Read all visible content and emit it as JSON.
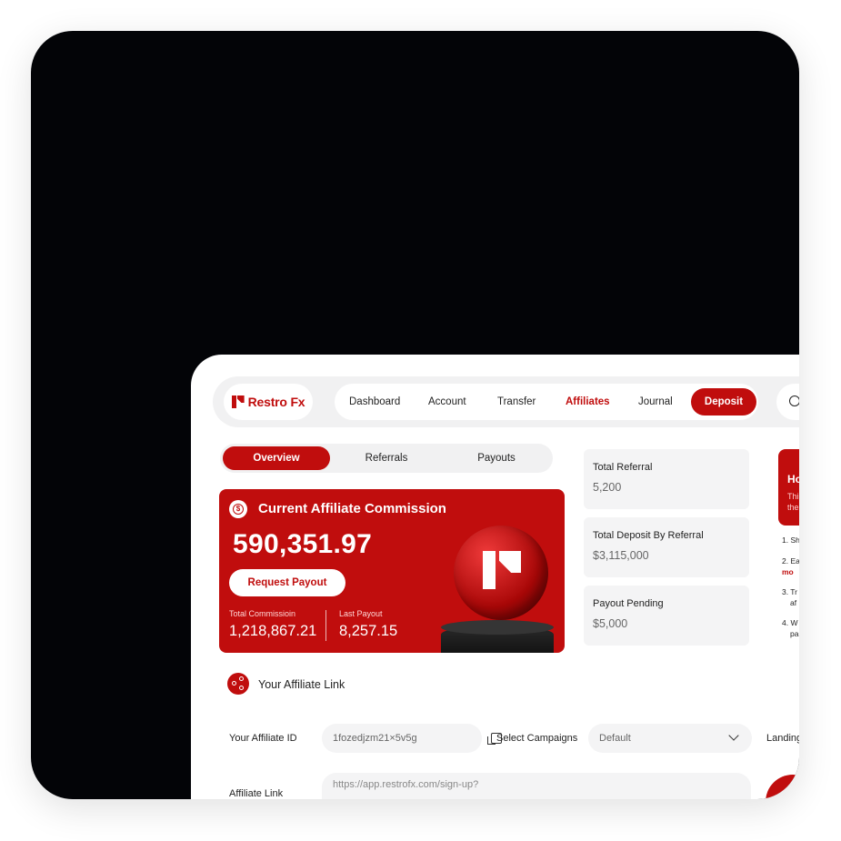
{
  "brand": {
    "name": "Restro Fx",
    "accent": "#c00d0d"
  },
  "nav": {
    "items": [
      "Dashboard",
      "Account",
      "Transfer",
      "Affiliates",
      "Journal"
    ],
    "active": "Affiliates",
    "deposit_label": "Deposit",
    "search_icon": "search-icon"
  },
  "tabs": {
    "items": [
      "Overview",
      "Referrals",
      "Payouts"
    ],
    "active": "Overview"
  },
  "commission": {
    "title": "Current Affiliate Commission",
    "amount": "590,351.97",
    "button": "Request Payout",
    "total_label": "Total Commissioin",
    "total_value": "1,218,867.21",
    "last_label": "Last Payout",
    "last_value": "8,257.15"
  },
  "stats": [
    {
      "label": "Total Referral",
      "value": "5,200"
    },
    {
      "label": "Total Deposit By Referral",
      "value": "$3,115,000"
    },
    {
      "label": "Payout Pending",
      "value": "$5,000"
    }
  ],
  "how_panel": {
    "heading": "Ho",
    "sub1": "Thi",
    "sub2": "the",
    "steps": [
      "1. Sh",
      "2. Ea",
      "mo",
      "3. Tr",
      "af",
      "4. W",
      "pa"
    ]
  },
  "affiliate_link": {
    "title": "Your Affiliate Link",
    "id_label": "Your Affiliate ID",
    "id_value": "1fozedjzm21×5v5g",
    "campaign_label": "Select Campaigns",
    "campaign_value": "Default",
    "landing_label": "Landing",
    "link_label": "Affiliate Link",
    "link_value": "https://app.restrofx.com/sign-up?"
  }
}
